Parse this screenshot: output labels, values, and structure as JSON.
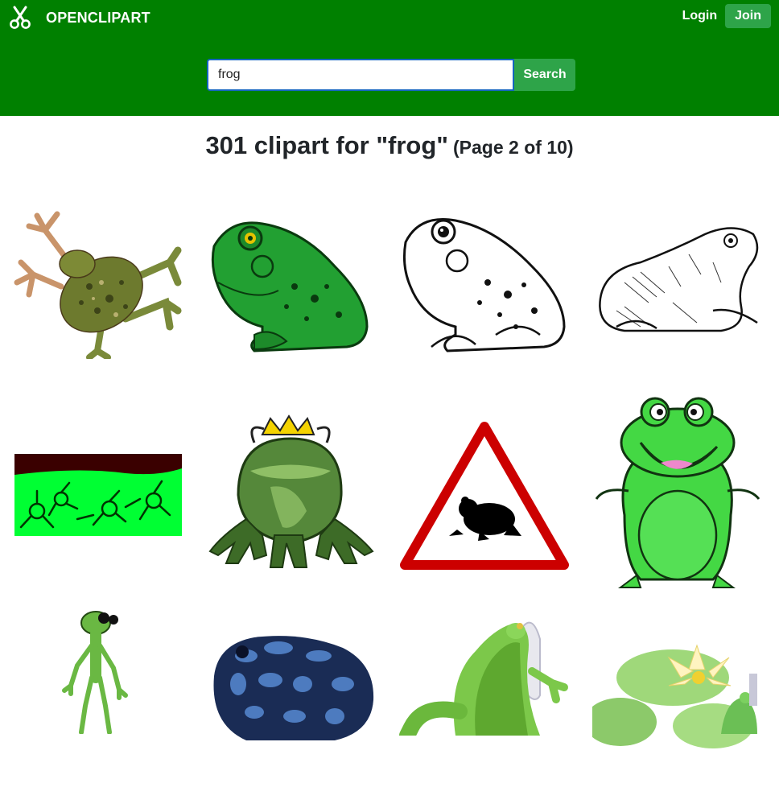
{
  "brand": {
    "name": "OPENCLIPART",
    "icon": "scissors-icon"
  },
  "nav": {
    "login_label": "Login",
    "join_label": "Join"
  },
  "search": {
    "value": "frog",
    "button_label": "Search"
  },
  "results": {
    "heading": "301 clipart for \"frog\"",
    "page_info": "(Page 2 of 10)"
  },
  "colors": {
    "header_bg": "#008000",
    "button_green": "#2ea449",
    "input_border": "#1565c0"
  },
  "clipart": [
    {
      "icon": "spotted-tree-frog-image"
    },
    {
      "icon": "green-bullfrog-image"
    },
    {
      "icon": "bullfrog-line-drawing-image"
    },
    {
      "icon": "sketched-toad-image"
    },
    {
      "icon": "frogs-banner-image"
    },
    {
      "icon": "frog-prince-image"
    },
    {
      "icon": "frog-warning-sign-image"
    },
    {
      "icon": "happy-cartoon-frog-image"
    },
    {
      "icon": "tall-thin-frog-image"
    },
    {
      "icon": "blue-poison-dart-frog-image"
    },
    {
      "icon": "green-frog-back-view-image"
    },
    {
      "icon": "frog-on-lily-pad-image"
    }
  ]
}
